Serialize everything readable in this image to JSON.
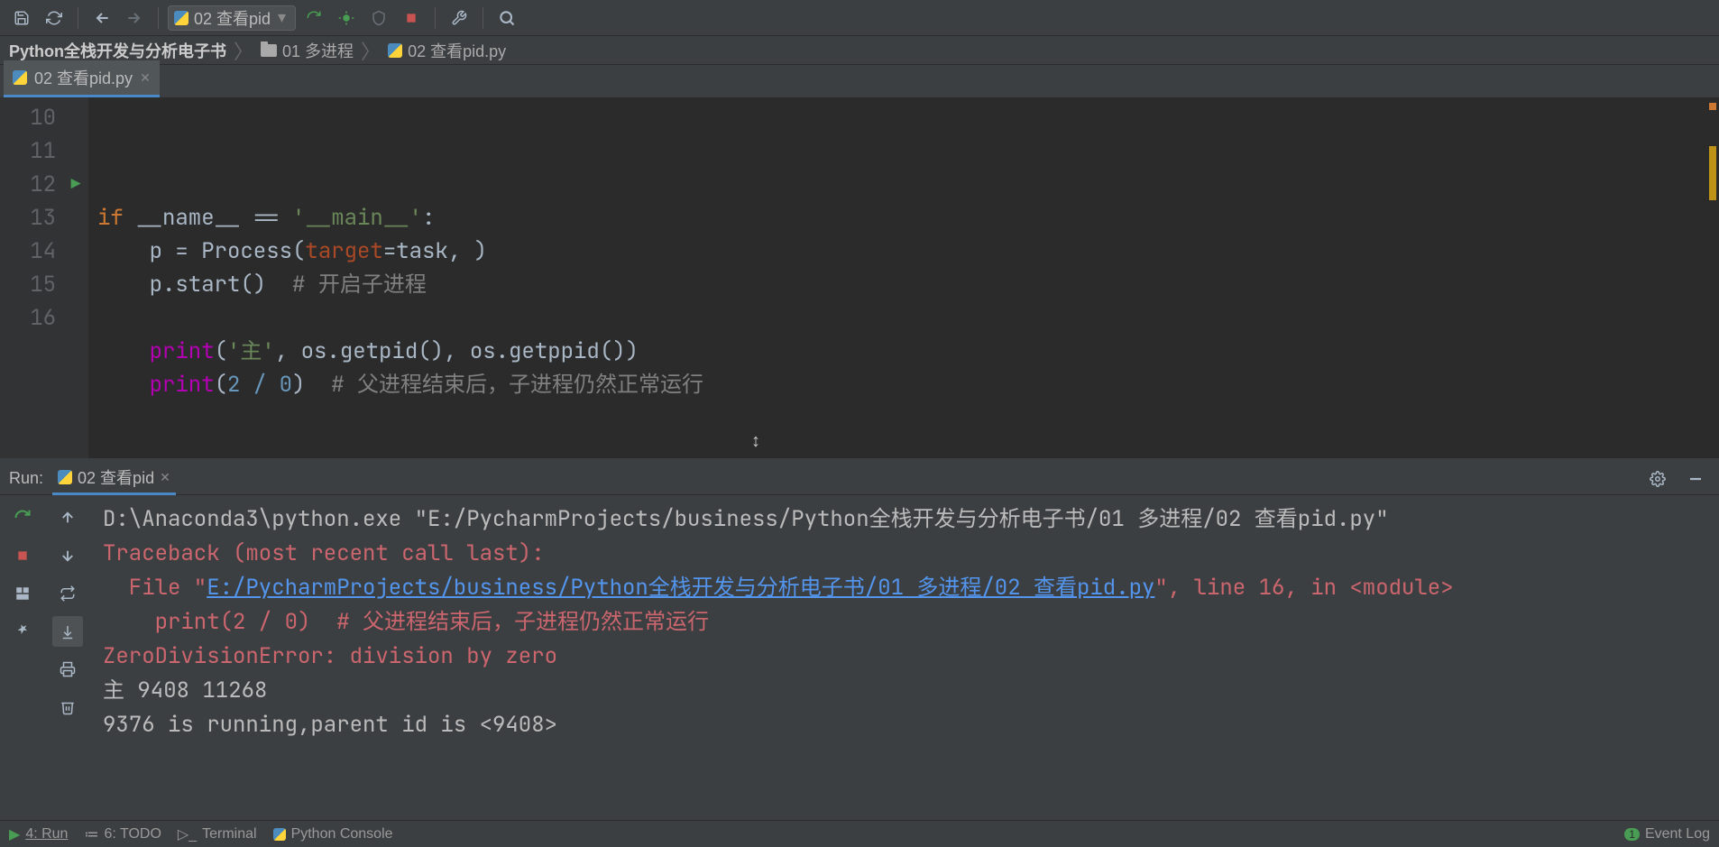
{
  "toolbar": {
    "run_config_label": "02 查看pid"
  },
  "breadcrumb": {
    "root": "Python全栈开发与分析电子书",
    "folder": "01 多进程",
    "file": "02 查看pid.py"
  },
  "editor_tab": {
    "label": "02 查看pid.py"
  },
  "gutter_lines": [
    "",
    "10",
    "11",
    "12",
    "13",
    "14",
    "15",
    "16",
    ""
  ],
  "code": {
    "l9": "",
    "l10": "",
    "l11_if": "if",
    "l11_name": " __name__ ",
    "l11_eq": "== ",
    "l11_str": "'__main__'",
    "l11_colon": ":",
    "l12_indent": "    ",
    "l12_p": "p = Process(",
    "l12_target": "target",
    "l12_rest": "=task, )",
    "l13_indent": "    ",
    "l13_code": "p.start()  ",
    "l13_cmt": "# 开启子进程",
    "l14": "",
    "l15_indent": "    ",
    "l15_print": "print",
    "l15_open": "(",
    "l15_str": "'主'",
    "l15_rest": ", os.getpid(), os.getppid())",
    "l16_indent": "    ",
    "l16_print": "print",
    "l16_open": "(",
    "l16_nums": "2 / 0",
    "l16_close": ")  ",
    "l16_cmt": "# 父进程结束后，子进程仍然正常运行"
  },
  "run": {
    "label": "Run:",
    "tab": "02 查看pid",
    "cmd": "D:\\Anaconda3\\python.exe \"E:/PycharmProjects/business/Python全栈开发与分析电子书/01 多进程/02 查看pid.py\"",
    "tb1": "Traceback (most recent call last):",
    "tb2a": "  File \"",
    "tb2link": "E:/PycharmProjects/business/Python全栈开发与分析电子书/01 多进程/02 查看pid.py",
    "tb2b": "\", line 16, in <module>",
    "tb3": "    print(2 / 0)  # 父进程结束后，子进程仍然正常运行",
    "tb4": "ZeroDivisionError: division by zero",
    "out1": "主 9408 11268",
    "out2": "9376 is running,parent id is <9408>"
  },
  "bottom": {
    "run": "4: Run",
    "todo": "6: TODO",
    "terminal": "Terminal",
    "python_console": "Python Console",
    "event_log": "Event Log",
    "event_badge": "1"
  }
}
